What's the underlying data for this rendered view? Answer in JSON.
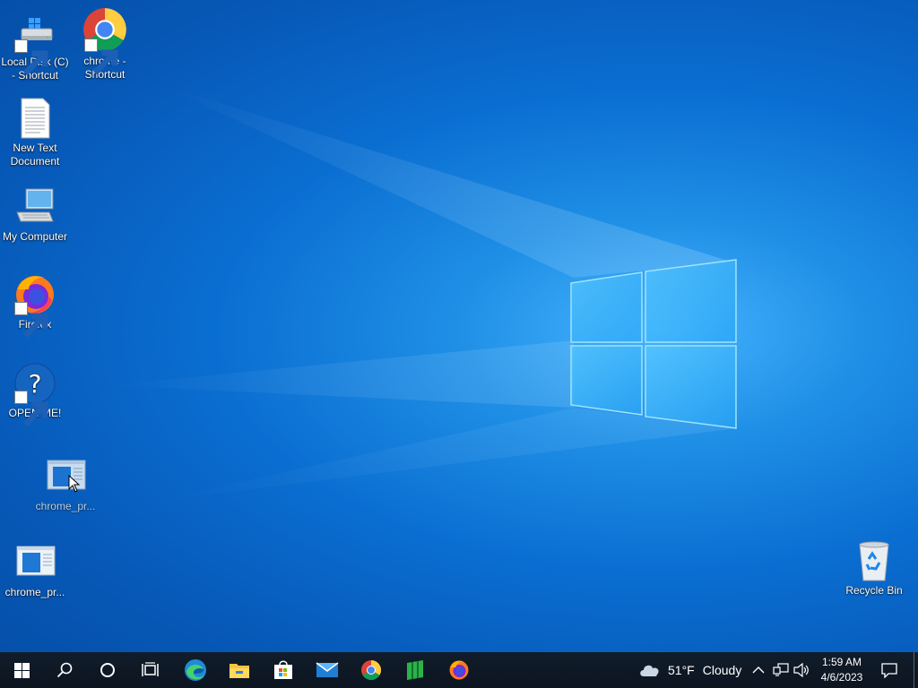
{
  "desktop": {
    "icons": [
      {
        "label": "Local Disk (C) - Shortcut"
      },
      {
        "label": "chrome - Shortcut"
      },
      {
        "label": "New Text Document"
      },
      {
        "label": "My Computer"
      },
      {
        "label": "Firefox"
      },
      {
        "label": "OPEN ME!"
      },
      {
        "label": "chrome_pr..."
      },
      {
        "label": "chrome_pr..."
      },
      {
        "label": "Recycle Bin"
      }
    ]
  },
  "taskbar": {
    "start_icon": "windows-start-icon",
    "pinned": [
      "search-icon",
      "cortana-icon",
      "task-view-icon",
      "edge-icon",
      "file-explorer-icon",
      "store-icon",
      "mail-icon",
      "chrome-icon",
      "green-app-icon",
      "firefox-icon"
    ],
    "weather": {
      "temp": "51°F",
      "condition": "Cloudy"
    },
    "clock": {
      "time": "1:59 AM",
      "date": "4/6/2023"
    }
  },
  "colors": {
    "accent": "#0a6ed1",
    "taskbar": "#0f1a26"
  }
}
